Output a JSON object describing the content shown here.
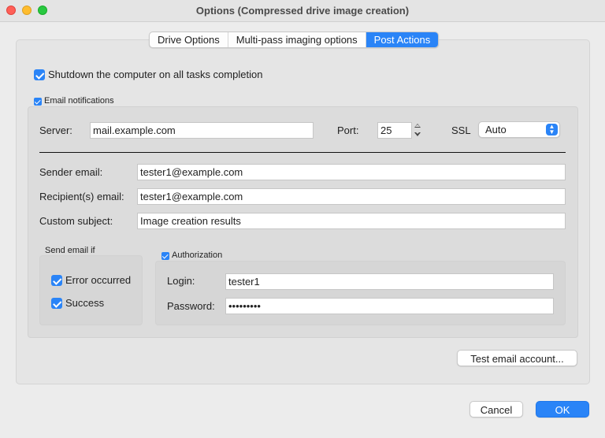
{
  "window": {
    "title": "Options (Compressed drive image creation)"
  },
  "tabs": [
    {
      "label": "Drive Options"
    },
    {
      "label": "Multi-pass imaging options"
    },
    {
      "label": "Post Actions"
    }
  ],
  "post_actions": {
    "shutdown_label": "Shutdown the computer on all tasks completion",
    "shutdown_checked": true,
    "email_notifications_label": "Email notifications",
    "email_notifications_checked": true,
    "server_label": "Server:",
    "server_value": "mail.example.com",
    "port_label": "Port:",
    "port_value": "25",
    "ssl_label": "SSL",
    "ssl_value": "Auto",
    "sender_label": "Sender email:",
    "sender_value": "tester1@example.com",
    "recipient_label": "Recipient(s) email:",
    "recipient_value": "tester1@example.com",
    "subject_label": "Custom subject:",
    "subject_value": "Image creation results",
    "send_if_label": "Send email if",
    "error_label": "Error occurred",
    "error_checked": true,
    "success_label": "Success",
    "success_checked": true,
    "authorization_label": "Authorization",
    "authorization_checked": true,
    "login_label": "Login:",
    "login_value": "tester1",
    "password_label": "Password:",
    "password_value": "•••••••••",
    "test_button": "Test email account..."
  },
  "footer": {
    "cancel": "Cancel",
    "ok": "OK"
  },
  "colors": {
    "accent": "#2a84f7",
    "close": "#ff5f57",
    "minimize": "#febc2e",
    "maximize": "#28c840"
  }
}
